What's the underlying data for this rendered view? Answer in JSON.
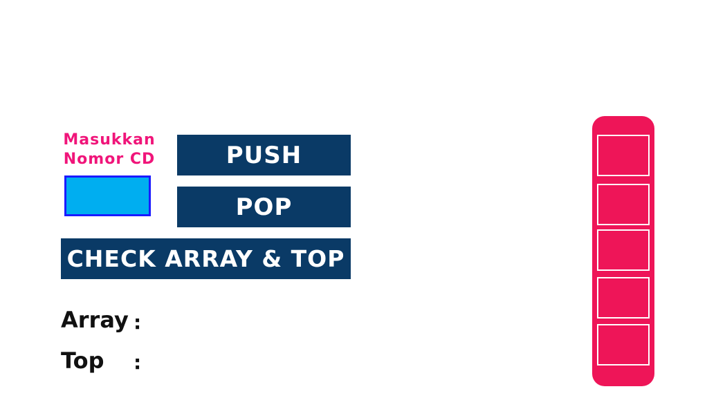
{
  "form": {
    "input_label_line1": "Masukkan",
    "input_label_line2": "Nomor  CD",
    "input_value": "",
    "push_label": "PUSH",
    "pop_label": "POP",
    "check_label": "CHECK ARRAY & TOP"
  },
  "output": {
    "array_label": "Array",
    "array_colon": ":",
    "array_value": "",
    "top_label": "Top",
    "top_colon": ":",
    "top_value": ""
  },
  "stack": {
    "slot_count": 5,
    "slots": [
      "",
      "",
      "",
      "",
      ""
    ]
  },
  "colors": {
    "label_pink": "#f0157a",
    "input_fill": "#00aef0",
    "input_border": "#1a1aff",
    "button_navy": "#0a3a66",
    "stack_fill": "#ee1558"
  }
}
